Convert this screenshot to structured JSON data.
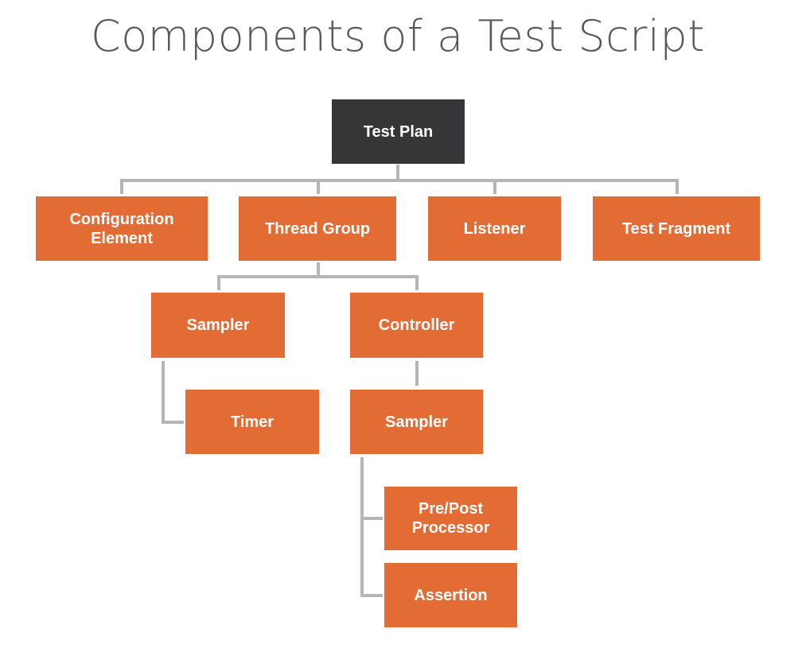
{
  "title": "Components of a Test Script",
  "colors": {
    "root": "#363638",
    "node": "#e36b34",
    "connector": "#b5b5b5",
    "text": "#ffffff",
    "title": "#58595b"
  },
  "nodes": {
    "test_plan": "Test Plan",
    "configuration_element": "Configuration Element",
    "thread_group": "Thread Group",
    "listener": "Listener",
    "test_fragment": "Test Fragment",
    "sampler": "Sampler",
    "controller": "Controller",
    "timer": "Timer",
    "controller_sampler": "Sampler",
    "pre_post_processor": "Pre/Post Processor",
    "assertion": "Assertion"
  },
  "edges": [
    [
      "Test Plan",
      "Configuration Element"
    ],
    [
      "Test Plan",
      "Thread Group"
    ],
    [
      "Test Plan",
      "Listener"
    ],
    [
      "Test Plan",
      "Test Fragment"
    ],
    [
      "Thread Group",
      "Sampler"
    ],
    [
      "Thread Group",
      "Controller"
    ],
    [
      "Sampler",
      "Timer"
    ],
    [
      "Controller",
      "Sampler"
    ],
    [
      "Sampler",
      "Pre/Post Processor"
    ],
    [
      "Sampler",
      "Assertion"
    ]
  ]
}
